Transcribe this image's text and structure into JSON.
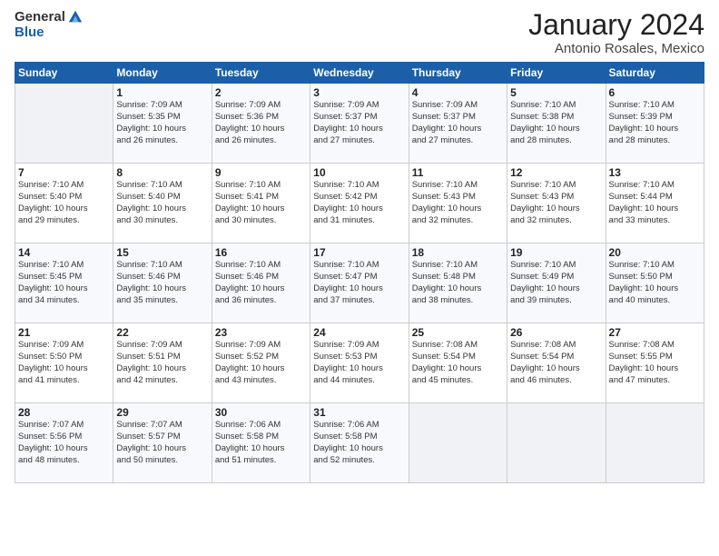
{
  "header": {
    "logo_general": "General",
    "logo_blue": "Blue",
    "month": "January 2024",
    "location": "Antonio Rosales, Mexico"
  },
  "days_of_week": [
    "Sunday",
    "Monday",
    "Tuesday",
    "Wednesday",
    "Thursday",
    "Friday",
    "Saturday"
  ],
  "weeks": [
    [
      {
        "num": "",
        "info": ""
      },
      {
        "num": "1",
        "info": "Sunrise: 7:09 AM\nSunset: 5:35 PM\nDaylight: 10 hours\nand 26 minutes."
      },
      {
        "num": "2",
        "info": "Sunrise: 7:09 AM\nSunset: 5:36 PM\nDaylight: 10 hours\nand 26 minutes."
      },
      {
        "num": "3",
        "info": "Sunrise: 7:09 AM\nSunset: 5:37 PM\nDaylight: 10 hours\nand 27 minutes."
      },
      {
        "num": "4",
        "info": "Sunrise: 7:09 AM\nSunset: 5:37 PM\nDaylight: 10 hours\nand 27 minutes."
      },
      {
        "num": "5",
        "info": "Sunrise: 7:10 AM\nSunset: 5:38 PM\nDaylight: 10 hours\nand 28 minutes."
      },
      {
        "num": "6",
        "info": "Sunrise: 7:10 AM\nSunset: 5:39 PM\nDaylight: 10 hours\nand 28 minutes."
      }
    ],
    [
      {
        "num": "7",
        "info": "Sunrise: 7:10 AM\nSunset: 5:40 PM\nDaylight: 10 hours\nand 29 minutes."
      },
      {
        "num": "8",
        "info": "Sunrise: 7:10 AM\nSunset: 5:40 PM\nDaylight: 10 hours\nand 30 minutes."
      },
      {
        "num": "9",
        "info": "Sunrise: 7:10 AM\nSunset: 5:41 PM\nDaylight: 10 hours\nand 30 minutes."
      },
      {
        "num": "10",
        "info": "Sunrise: 7:10 AM\nSunset: 5:42 PM\nDaylight: 10 hours\nand 31 minutes."
      },
      {
        "num": "11",
        "info": "Sunrise: 7:10 AM\nSunset: 5:43 PM\nDaylight: 10 hours\nand 32 minutes."
      },
      {
        "num": "12",
        "info": "Sunrise: 7:10 AM\nSunset: 5:43 PM\nDaylight: 10 hours\nand 32 minutes."
      },
      {
        "num": "13",
        "info": "Sunrise: 7:10 AM\nSunset: 5:44 PM\nDaylight: 10 hours\nand 33 minutes."
      }
    ],
    [
      {
        "num": "14",
        "info": "Sunrise: 7:10 AM\nSunset: 5:45 PM\nDaylight: 10 hours\nand 34 minutes."
      },
      {
        "num": "15",
        "info": "Sunrise: 7:10 AM\nSunset: 5:46 PM\nDaylight: 10 hours\nand 35 minutes."
      },
      {
        "num": "16",
        "info": "Sunrise: 7:10 AM\nSunset: 5:46 PM\nDaylight: 10 hours\nand 36 minutes."
      },
      {
        "num": "17",
        "info": "Sunrise: 7:10 AM\nSunset: 5:47 PM\nDaylight: 10 hours\nand 37 minutes."
      },
      {
        "num": "18",
        "info": "Sunrise: 7:10 AM\nSunset: 5:48 PM\nDaylight: 10 hours\nand 38 minutes."
      },
      {
        "num": "19",
        "info": "Sunrise: 7:10 AM\nSunset: 5:49 PM\nDaylight: 10 hours\nand 39 minutes."
      },
      {
        "num": "20",
        "info": "Sunrise: 7:10 AM\nSunset: 5:50 PM\nDaylight: 10 hours\nand 40 minutes."
      }
    ],
    [
      {
        "num": "21",
        "info": "Sunrise: 7:09 AM\nSunset: 5:50 PM\nDaylight: 10 hours\nand 41 minutes."
      },
      {
        "num": "22",
        "info": "Sunrise: 7:09 AM\nSunset: 5:51 PM\nDaylight: 10 hours\nand 42 minutes."
      },
      {
        "num": "23",
        "info": "Sunrise: 7:09 AM\nSunset: 5:52 PM\nDaylight: 10 hours\nand 43 minutes."
      },
      {
        "num": "24",
        "info": "Sunrise: 7:09 AM\nSunset: 5:53 PM\nDaylight: 10 hours\nand 44 minutes."
      },
      {
        "num": "25",
        "info": "Sunrise: 7:08 AM\nSunset: 5:54 PM\nDaylight: 10 hours\nand 45 minutes."
      },
      {
        "num": "26",
        "info": "Sunrise: 7:08 AM\nSunset: 5:54 PM\nDaylight: 10 hours\nand 46 minutes."
      },
      {
        "num": "27",
        "info": "Sunrise: 7:08 AM\nSunset: 5:55 PM\nDaylight: 10 hours\nand 47 minutes."
      }
    ],
    [
      {
        "num": "28",
        "info": "Sunrise: 7:07 AM\nSunset: 5:56 PM\nDaylight: 10 hours\nand 48 minutes."
      },
      {
        "num": "29",
        "info": "Sunrise: 7:07 AM\nSunset: 5:57 PM\nDaylight: 10 hours\nand 50 minutes."
      },
      {
        "num": "30",
        "info": "Sunrise: 7:06 AM\nSunset: 5:58 PM\nDaylight: 10 hours\nand 51 minutes."
      },
      {
        "num": "31",
        "info": "Sunrise: 7:06 AM\nSunset: 5:58 PM\nDaylight: 10 hours\nand 52 minutes."
      },
      {
        "num": "",
        "info": ""
      },
      {
        "num": "",
        "info": ""
      },
      {
        "num": "",
        "info": ""
      }
    ]
  ]
}
